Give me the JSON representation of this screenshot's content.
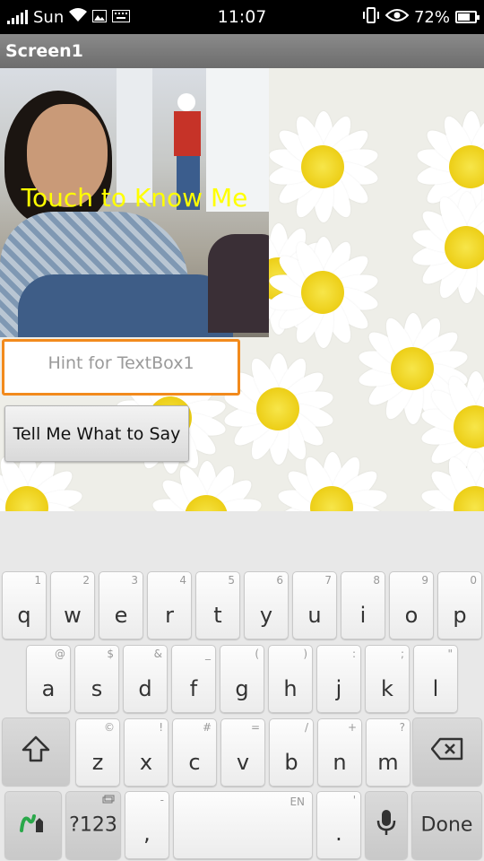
{
  "status_bar": {
    "carrier": "Sun",
    "time": "11:07",
    "battery": "72%",
    "battery_level": 0.72
  },
  "title_bar": {
    "title": "Screen1"
  },
  "app": {
    "photo_label": "Touch to Know Me",
    "textbox_hint": "Hint for TextBox1",
    "button_label": "Tell Me What to Say"
  },
  "keyboard": {
    "row1": [
      {
        "main": "q",
        "alt": "1"
      },
      {
        "main": "w",
        "alt": "2"
      },
      {
        "main": "e",
        "alt": "3"
      },
      {
        "main": "r",
        "alt": "4"
      },
      {
        "main": "t",
        "alt": "5"
      },
      {
        "main": "y",
        "alt": "6"
      },
      {
        "main": "u",
        "alt": "7"
      },
      {
        "main": "i",
        "alt": "8"
      },
      {
        "main": "o",
        "alt": "9"
      },
      {
        "main": "p",
        "alt": "0"
      }
    ],
    "row2": [
      {
        "main": "a",
        "alt": "@"
      },
      {
        "main": "s",
        "alt": "$"
      },
      {
        "main": "d",
        "alt": "&"
      },
      {
        "main": "f",
        "alt": "_"
      },
      {
        "main": "g",
        "alt": "("
      },
      {
        "main": "h",
        "alt": ")"
      },
      {
        "main": "j",
        "alt": ":"
      },
      {
        "main": "k",
        "alt": ";"
      },
      {
        "main": "l",
        "alt": "\""
      }
    ],
    "row3": [
      {
        "main": "z",
        "alt": "©"
      },
      {
        "main": "x",
        "alt": "!"
      },
      {
        "main": "c",
        "alt": "#"
      },
      {
        "main": "v",
        "alt": "="
      },
      {
        "main": "b",
        "alt": "/"
      },
      {
        "main": "n",
        "alt": "+"
      },
      {
        "main": "m",
        "alt": "?"
      }
    ],
    "symbols_label": "?123",
    "comma_label": ",",
    "comma_alt": "-",
    "space_language": "EN",
    "period_label": ".",
    "period_alt": "'",
    "done_label": "Done",
    "icons": {
      "shift": "shift-icon",
      "backspace": "backspace-icon",
      "swype": "swype-icon",
      "mic": "microphone-icon",
      "clipboard": "clipboard-icon"
    }
  }
}
